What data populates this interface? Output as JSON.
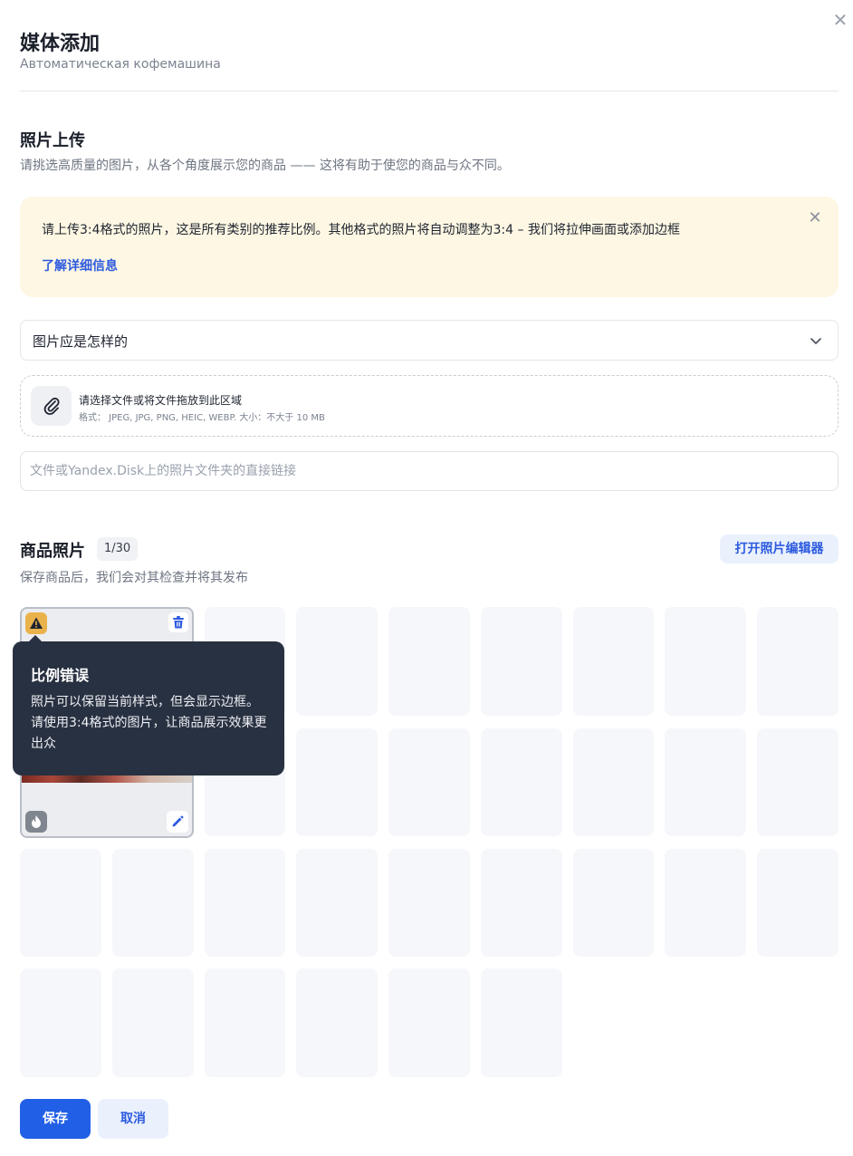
{
  "header": {
    "title": "媒体添加",
    "subtitle": "Автоматическая кофемашина",
    "close_icon": "close-icon"
  },
  "upload_section": {
    "title": "照片上传",
    "description": "请挑选高质量的图片，从各个角度展示您的商品 —— 这将有助于使您的商品与众不同。"
  },
  "notice": {
    "text": "请上传3:4格式的照片，这是所有类别的推荐比例。其他格式的照片将自动调整为3:4 – 我们将拉伸画面或添加边框",
    "link": "了解详细信息",
    "background_color": "#fdf7e3"
  },
  "accordion": {
    "label": "图片应是怎样的"
  },
  "dropzone": {
    "main_text": "请选择文件或将文件拖放到此区域",
    "formats_text": "格式： JPEG, JPG, PNG, HEIC, WEBP. 大小：不大于 10 MB"
  },
  "link_input": {
    "placeholder": "文件或Yandex.Disk上的照片文件夹的直接链接",
    "value": ""
  },
  "photos_section": {
    "title": "商品照片",
    "count": "1/30",
    "editor_button": "打开照片编辑器",
    "description": "保存商品后，我们会对其检查并将其发布"
  },
  "tooltip": {
    "title": "比例错误",
    "body": "照片可以保留当前样式，但会显示边框。请使用3:4格式的图片，让商品展示效果更出众"
  },
  "footer": {
    "save_label": "保存",
    "cancel_label": "取消"
  },
  "colors": {
    "primary": "#2160e6",
    "link": "#2d5bdf",
    "warning": "#e9b24a",
    "tooltip_bg": "#283141"
  }
}
